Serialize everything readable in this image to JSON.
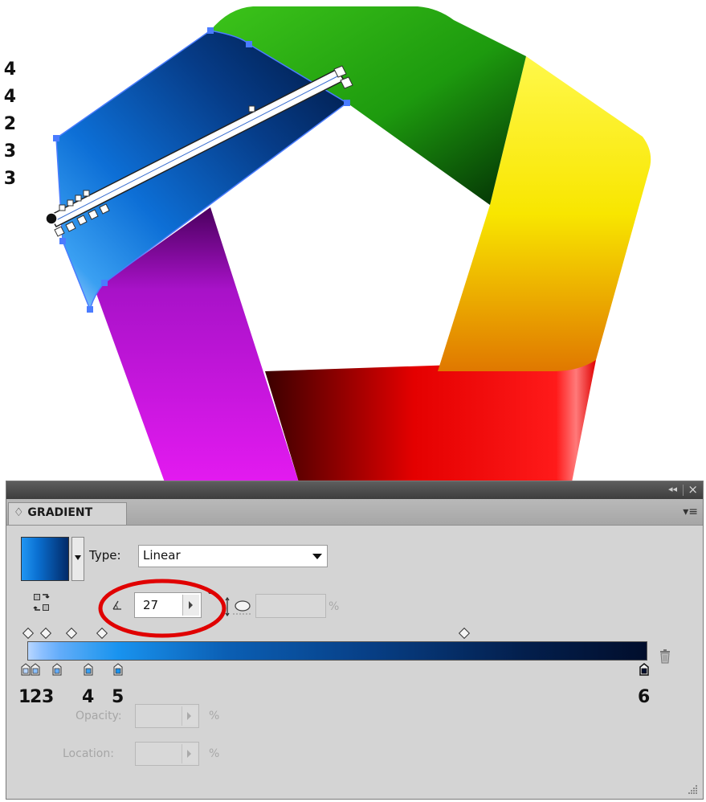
{
  "side_digits": [
    "4",
    "4",
    "2",
    "3",
    "3"
  ],
  "panel": {
    "title": "♢ GRADIENT",
    "collapse_label": "◂◂",
    "close_label": "×",
    "menu_label": "▾≡"
  },
  "type_row": {
    "label": "Type:",
    "value": "Linear"
  },
  "angle": {
    "value": "27",
    "degree": "°"
  },
  "aspect_ratio": {
    "value": "",
    "unit": "%"
  },
  "gradient": {
    "colors": [
      "#b8d6ff",
      "#8cc0ff",
      "#64adfa",
      "#3aa0f2",
      "#1993ef",
      "#010e2c"
    ],
    "stop_labels": [
      "1",
      "2",
      "3",
      "4",
      "5",
      "6"
    ]
  },
  "opacity": {
    "label": "Opacity:",
    "value": "",
    "unit": "%"
  },
  "location": {
    "label": "Location:",
    "value": "",
    "unit": "%"
  },
  "annotation_color": "#e00000"
}
